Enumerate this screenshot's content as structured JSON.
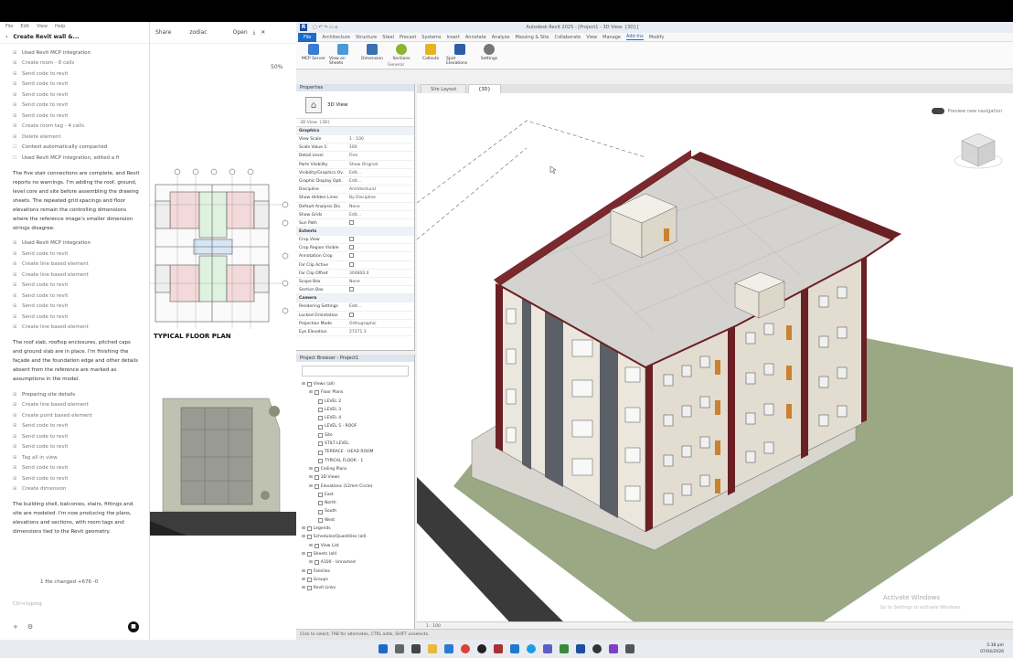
{
  "chat": {
    "menu": [
      "File",
      "Edit",
      "View",
      "Help"
    ],
    "title": "Create Revit wall &...",
    "tabs": [
      "Share",
      "zodiac",
      "Open"
    ],
    "items_top": [
      {
        "text": "Used Revit MCP integration",
        "head": true
      },
      {
        "text": "Create room - 8 calls"
      },
      {
        "text": "Send code to revit"
      },
      {
        "text": "Send code to revit"
      },
      {
        "text": "Send code to revit"
      },
      {
        "text": "Send code to revit"
      },
      {
        "text": "Send code to revit"
      },
      {
        "text": "Create room tag - 4 calls"
      },
      {
        "text": "Delete element"
      }
    ],
    "compacted": "Context automatically compacted",
    "edited": "Used Revit MCP integration, edited a fi",
    "para1": "The five stair connections are complete, and Revit reports no warnings. I'm adding the roof, ground, level core and site before assembling the drawing sheets. The repeated grid spacings and floor elevations remain the controlling dimensions where the reference image's smaller dimension strings disagree.",
    "items_mid": [
      {
        "text": "Used Revit MCP integration",
        "head": true
      },
      {
        "text": "Send code to revit"
      },
      {
        "text": "Create line based element"
      },
      {
        "text": "Create line based element"
      },
      {
        "text": "Send code to revit"
      },
      {
        "text": "Send code to revit"
      },
      {
        "text": "Send code to revit"
      },
      {
        "text": "Send code to revit"
      },
      {
        "text": "Create line based element"
      }
    ],
    "para2": "The roof slab, rooftop enclosures, pitched caps and ground slab are in place. I'm finishing the façade and the foundation edge and other details absent from the reference are marked as assumptions in the model.",
    "items_bot": [
      {
        "text": "Preparing site details",
        "head": true
      },
      {
        "text": "Create line based element"
      },
      {
        "text": "Create point based element"
      },
      {
        "text": "Send code to revit"
      },
      {
        "text": "Send code to revit"
      },
      {
        "text": "Send code to revit"
      },
      {
        "text": "Tag all in view"
      },
      {
        "text": "Send code to revit"
      },
      {
        "text": "Send code to revit"
      },
      {
        "text": "Create dimension"
      }
    ],
    "para3": "The building shell, balconies, stairs, fittings and site are modeled. I'm now producing the plans, elevations and sections, with room tags and dimensions tied to the Revit geometry.",
    "files_changed": "1 file changed +676 -0",
    "input_placeholder": "Ctrl+typing"
  },
  "preview": {
    "zoom": "50%",
    "floorplan_caption": "TYPICAL FLOOR PLAN"
  },
  "revit": {
    "title": "Autodesk Revit 2025 - [Project1 - 3D View: {3D}]",
    "ribbon_tabs": [
      "File",
      "Architecture",
      "Structure",
      "Steel",
      "Precast",
      "Systems",
      "Insert",
      "Annotate",
      "Analyze",
      "Massing & Site",
      "Collaborate",
      "View",
      "Manage",
      "Add-Ins",
      "Modify"
    ],
    "ribbon_buttons": [
      "MCP Server",
      "View on Sheets",
      "Dimension",
      "Sections",
      "Callouts",
      "Spot Elevations",
      "Settings"
    ],
    "ribbon_group": "General",
    "properties_title": "Properties",
    "type_name": "3D View",
    "filter": "3D View: {3D}",
    "sections": {
      "graphics": "Graphics",
      "extents": "Extents",
      "camera": "Camera"
    },
    "graphics_rows": [
      {
        "k": "View Scale",
        "v": "1 : 100"
      },
      {
        "k": "Scale Value 1:",
        "v": "100"
      },
      {
        "k": "Detail Level",
        "v": "Fine"
      },
      {
        "k": "Parts Visibility",
        "v": "Show Original"
      },
      {
        "k": "Visibility/Graphics Ov.",
        "v": "Edit..."
      },
      {
        "k": "Graphic Display Opti.",
        "v": "Edit..."
      },
      {
        "k": "Discipline",
        "v": "Architectural"
      },
      {
        "k": "Show Hidden Lines",
        "v": "By Discipline"
      },
      {
        "k": "Default Analysis Dis.",
        "v": "None"
      },
      {
        "k": "Show Grids",
        "v": "Edit..."
      },
      {
        "k": "Sun Path",
        "v": ""
      }
    ],
    "extents_rows": [
      {
        "k": "Crop View",
        "v": ""
      },
      {
        "k": "Crop Region Visible",
        "v": ""
      },
      {
        "k": "Annotation Crop",
        "v": ""
      },
      {
        "k": "Far Clip Active",
        "v": ""
      },
      {
        "k": "Far Clip Offset",
        "v": "304800.0"
      },
      {
        "k": "Scope Box",
        "v": "None"
      },
      {
        "k": "Section Box",
        "v": ""
      }
    ],
    "camera_rows": [
      {
        "k": "Rendering Settings",
        "v": "Edit..."
      },
      {
        "k": "Locked Orientation",
        "v": ""
      },
      {
        "k": "Projection Mode",
        "v": "Orthographic"
      },
      {
        "k": "Eye Elevation",
        "v": "27271.3"
      }
    ],
    "browser_title": "Project Browser - Project1",
    "tree": [
      {
        "t": "Views (all)",
        "d": 0
      },
      {
        "t": "Floor Plans",
        "d": 1
      },
      {
        "t": "LEVEL 2",
        "d": 2
      },
      {
        "t": "LEVEL 3",
        "d": 2
      },
      {
        "t": "LEVEL 4",
        "d": 2
      },
      {
        "t": "LEVEL 5 - ROOF",
        "d": 2
      },
      {
        "t": "Site",
        "d": 2
      },
      {
        "t": "STILT LEVEL",
        "d": 2
      },
      {
        "t": "TERRACE - HEAD ROOM",
        "d": 2
      },
      {
        "t": "TYPICAL FLOOR - 1",
        "d": 2
      },
      {
        "t": "Ceiling Plans",
        "d": 1
      },
      {
        "t": "3D Views",
        "d": 1
      },
      {
        "t": "Elevations (12mm Circle)",
        "d": 1
      },
      {
        "t": "East",
        "d": 2
      },
      {
        "t": "North",
        "d": 2
      },
      {
        "t": "South",
        "d": 2
      },
      {
        "t": "West",
        "d": 2
      },
      {
        "t": "Legends",
        "d": 0
      },
      {
        "t": "Schedules/Quantities (all)",
        "d": 0
      },
      {
        "t": "View List",
        "d": 1
      },
      {
        "t": "Sheets (all)",
        "d": 0
      },
      {
        "t": "A100 - Unnamed",
        "d": 1
      },
      {
        "t": "Families",
        "d": 0
      },
      {
        "t": "Groups",
        "d": 0
      },
      {
        "t": "Revit Links",
        "d": 0
      }
    ],
    "view_tabs": [
      "Site Layout",
      "{3D}"
    ],
    "pref_toggle": "Preview new navigation",
    "view_scale": "1 : 100",
    "status": "Click to select, TAB for alternates, CTRL adds, SHIFT unselects.",
    "watermark_title": "Activate Windows",
    "watermark_sub": "Go to Settings to activate Windows."
  },
  "taskbar": {
    "time": "5:38 pm",
    "date": "07/04/2026"
  },
  "colors": {
    "revit_blue": "#1c6ac9",
    "parapet": "#6b2024",
    "wall": "#e7e2d6",
    "roof": "#d4d3cf",
    "grass": "#9aa883"
  }
}
